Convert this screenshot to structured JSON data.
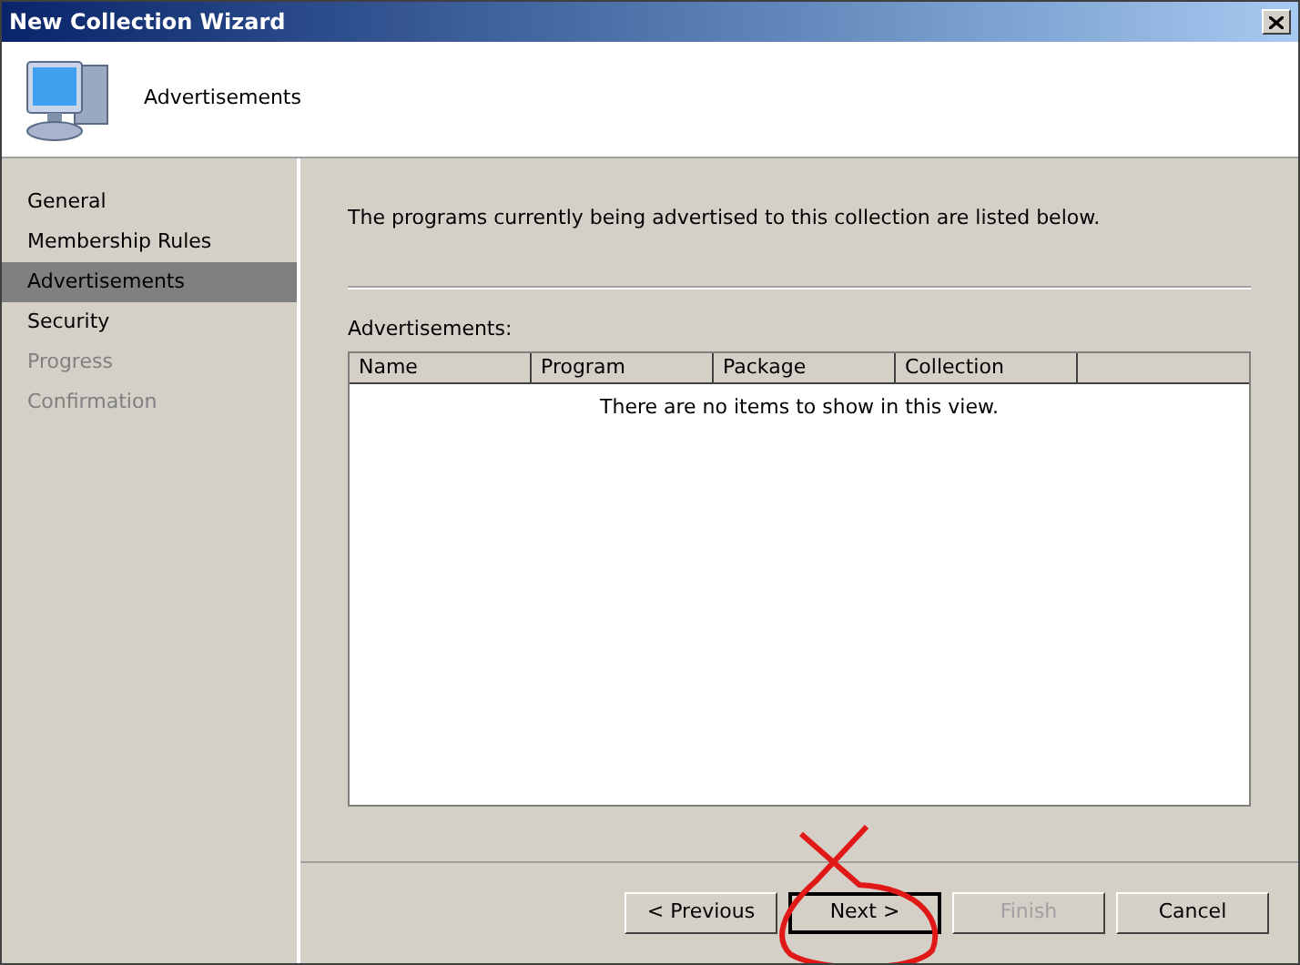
{
  "window": {
    "title": "New Collection Wizard"
  },
  "header": {
    "title": "Advertisements"
  },
  "steps": [
    {
      "label": "General",
      "selected": false,
      "disabled": false
    },
    {
      "label": "Membership Rules",
      "selected": false,
      "disabled": false
    },
    {
      "label": "Advertisements",
      "selected": true,
      "disabled": false
    },
    {
      "label": "Security",
      "selected": false,
      "disabled": false
    },
    {
      "label": "Progress",
      "selected": false,
      "disabled": true
    },
    {
      "label": "Confirmation",
      "selected": false,
      "disabled": true
    }
  ],
  "description": "The programs currently being advertised to this collection are listed below.",
  "list_label": "Advertisements:",
  "table": {
    "columns": [
      "Name",
      "Program",
      "Package",
      "Collection"
    ],
    "empty_message": "There are no items to show in this view."
  },
  "buttons": [
    {
      "label": "< Previous",
      "disabled": false,
      "default": false
    },
    {
      "label": "Next >",
      "disabled": false,
      "default": true
    },
    {
      "label": "Finish",
      "disabled": true,
      "default": false
    },
    {
      "label": "Cancel",
      "disabled": false,
      "default": false
    }
  ]
}
